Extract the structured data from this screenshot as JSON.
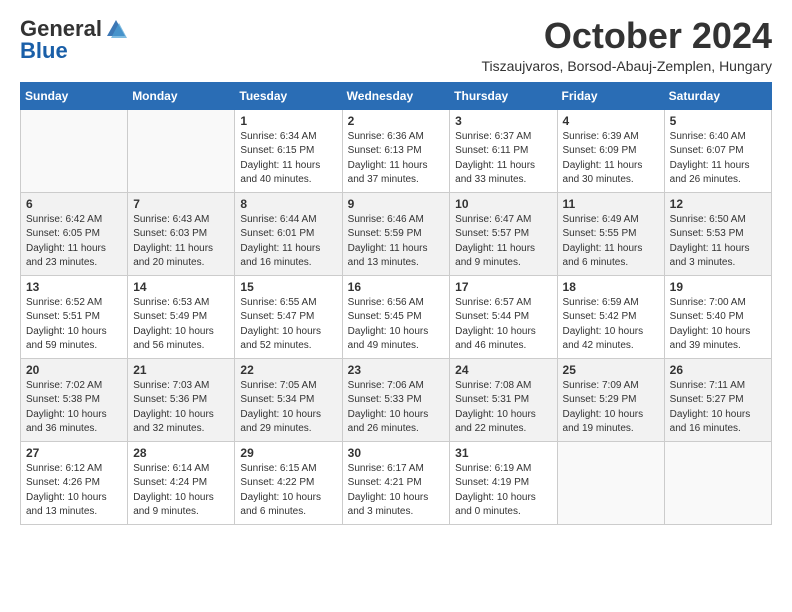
{
  "header": {
    "logo_general": "General",
    "logo_blue": "Blue",
    "month_title": "October 2024",
    "subtitle": "Tiszaujvaros, Borsod-Abauj-Zemplen, Hungary"
  },
  "days_of_week": [
    "Sunday",
    "Monday",
    "Tuesday",
    "Wednesday",
    "Thursday",
    "Friday",
    "Saturday"
  ],
  "weeks": [
    [
      {
        "day": "",
        "info": ""
      },
      {
        "day": "",
        "info": ""
      },
      {
        "day": "1",
        "info": "Sunrise: 6:34 AM\nSunset: 6:15 PM\nDaylight: 11 hours and 40 minutes."
      },
      {
        "day": "2",
        "info": "Sunrise: 6:36 AM\nSunset: 6:13 PM\nDaylight: 11 hours and 37 minutes."
      },
      {
        "day": "3",
        "info": "Sunrise: 6:37 AM\nSunset: 6:11 PM\nDaylight: 11 hours and 33 minutes."
      },
      {
        "day": "4",
        "info": "Sunrise: 6:39 AM\nSunset: 6:09 PM\nDaylight: 11 hours and 30 minutes."
      },
      {
        "day": "5",
        "info": "Sunrise: 6:40 AM\nSunset: 6:07 PM\nDaylight: 11 hours and 26 minutes."
      }
    ],
    [
      {
        "day": "6",
        "info": "Sunrise: 6:42 AM\nSunset: 6:05 PM\nDaylight: 11 hours and 23 minutes."
      },
      {
        "day": "7",
        "info": "Sunrise: 6:43 AM\nSunset: 6:03 PM\nDaylight: 11 hours and 20 minutes."
      },
      {
        "day": "8",
        "info": "Sunrise: 6:44 AM\nSunset: 6:01 PM\nDaylight: 11 hours and 16 minutes."
      },
      {
        "day": "9",
        "info": "Sunrise: 6:46 AM\nSunset: 5:59 PM\nDaylight: 11 hours and 13 minutes."
      },
      {
        "day": "10",
        "info": "Sunrise: 6:47 AM\nSunset: 5:57 PM\nDaylight: 11 hours and 9 minutes."
      },
      {
        "day": "11",
        "info": "Sunrise: 6:49 AM\nSunset: 5:55 PM\nDaylight: 11 hours and 6 minutes."
      },
      {
        "day": "12",
        "info": "Sunrise: 6:50 AM\nSunset: 5:53 PM\nDaylight: 11 hours and 3 minutes."
      }
    ],
    [
      {
        "day": "13",
        "info": "Sunrise: 6:52 AM\nSunset: 5:51 PM\nDaylight: 10 hours and 59 minutes."
      },
      {
        "day": "14",
        "info": "Sunrise: 6:53 AM\nSunset: 5:49 PM\nDaylight: 10 hours and 56 minutes."
      },
      {
        "day": "15",
        "info": "Sunrise: 6:55 AM\nSunset: 5:47 PM\nDaylight: 10 hours and 52 minutes."
      },
      {
        "day": "16",
        "info": "Sunrise: 6:56 AM\nSunset: 5:45 PM\nDaylight: 10 hours and 49 minutes."
      },
      {
        "day": "17",
        "info": "Sunrise: 6:57 AM\nSunset: 5:44 PM\nDaylight: 10 hours and 46 minutes."
      },
      {
        "day": "18",
        "info": "Sunrise: 6:59 AM\nSunset: 5:42 PM\nDaylight: 10 hours and 42 minutes."
      },
      {
        "day": "19",
        "info": "Sunrise: 7:00 AM\nSunset: 5:40 PM\nDaylight: 10 hours and 39 minutes."
      }
    ],
    [
      {
        "day": "20",
        "info": "Sunrise: 7:02 AM\nSunset: 5:38 PM\nDaylight: 10 hours and 36 minutes."
      },
      {
        "day": "21",
        "info": "Sunrise: 7:03 AM\nSunset: 5:36 PM\nDaylight: 10 hours and 32 minutes."
      },
      {
        "day": "22",
        "info": "Sunrise: 7:05 AM\nSunset: 5:34 PM\nDaylight: 10 hours and 29 minutes."
      },
      {
        "day": "23",
        "info": "Sunrise: 7:06 AM\nSunset: 5:33 PM\nDaylight: 10 hours and 26 minutes."
      },
      {
        "day": "24",
        "info": "Sunrise: 7:08 AM\nSunset: 5:31 PM\nDaylight: 10 hours and 22 minutes."
      },
      {
        "day": "25",
        "info": "Sunrise: 7:09 AM\nSunset: 5:29 PM\nDaylight: 10 hours and 19 minutes."
      },
      {
        "day": "26",
        "info": "Sunrise: 7:11 AM\nSunset: 5:27 PM\nDaylight: 10 hours and 16 minutes."
      }
    ],
    [
      {
        "day": "27",
        "info": "Sunrise: 6:12 AM\nSunset: 4:26 PM\nDaylight: 10 hours and 13 minutes."
      },
      {
        "day": "28",
        "info": "Sunrise: 6:14 AM\nSunset: 4:24 PM\nDaylight: 10 hours and 9 minutes."
      },
      {
        "day": "29",
        "info": "Sunrise: 6:15 AM\nSunset: 4:22 PM\nDaylight: 10 hours and 6 minutes."
      },
      {
        "day": "30",
        "info": "Sunrise: 6:17 AM\nSunset: 4:21 PM\nDaylight: 10 hours and 3 minutes."
      },
      {
        "day": "31",
        "info": "Sunrise: 6:19 AM\nSunset: 4:19 PM\nDaylight: 10 hours and 0 minutes."
      },
      {
        "day": "",
        "info": ""
      },
      {
        "day": "",
        "info": ""
      }
    ]
  ]
}
